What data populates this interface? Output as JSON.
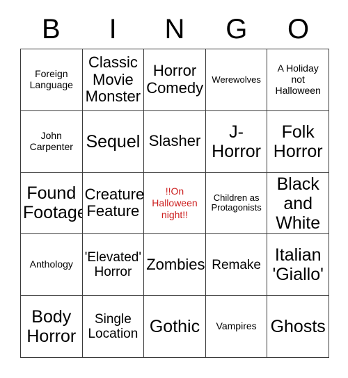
{
  "header": {
    "letters": [
      "B",
      "I",
      "N",
      "G",
      "O"
    ]
  },
  "colors": {
    "free_space_text": "#cc1f1f",
    "grid_border": "#3a3a3a",
    "cell_text": "#000000",
    "background": "#ffffff"
  },
  "grid": {
    "columns": 5,
    "rows": 5,
    "cells": [
      {
        "label": "Foreign\nLanguage",
        "size": "sm",
        "free": false
      },
      {
        "label": "Classic\nMovie\nMonster",
        "size": "lg",
        "free": false
      },
      {
        "label": "Horror\nComedy",
        "size": "lg",
        "free": false
      },
      {
        "label": "Werewolves",
        "size": "xs",
        "free": false
      },
      {
        "label": "A Holiday\nnot\nHalloween",
        "size": "sm",
        "free": false
      },
      {
        "label": "John\nCarpenter",
        "size": "sm",
        "free": false
      },
      {
        "label": "Sequel",
        "size": "xl",
        "free": false
      },
      {
        "label": "Slasher",
        "size": "lg",
        "free": false
      },
      {
        "label": "J-\nHorror",
        "size": "xl",
        "free": false
      },
      {
        "label": "Folk\nHorror",
        "size": "xl",
        "free": false
      },
      {
        "label": "Found\nFootage",
        "size": "xl",
        "free": false
      },
      {
        "label": "Creature\nFeature",
        "size": "lg",
        "free": false
      },
      {
        "label": "!!On\nHalloween\nnight!!",
        "size": "sm",
        "free": true
      },
      {
        "label": "Children as\nProtagonists",
        "size": "xs",
        "free": false
      },
      {
        "label": "Black\nand\nWhite",
        "size": "xl",
        "free": false
      },
      {
        "label": "Anthology",
        "size": "sm",
        "free": false
      },
      {
        "label": "'Elevated'\nHorror",
        "size": "md",
        "free": false
      },
      {
        "label": "Zombies",
        "size": "lg",
        "free": false
      },
      {
        "label": "Remake",
        "size": "md",
        "free": false
      },
      {
        "label": "Italian\n'Giallo'",
        "size": "xl",
        "free": false
      },
      {
        "label": "Body\nHorror",
        "size": "xl",
        "free": false
      },
      {
        "label": "Single\nLocation",
        "size": "md",
        "free": false
      },
      {
        "label": "Gothic",
        "size": "xl",
        "free": false
      },
      {
        "label": "Vampires",
        "size": "sm",
        "free": false
      },
      {
        "label": "Ghosts",
        "size": "xl",
        "free": false
      }
    ]
  }
}
